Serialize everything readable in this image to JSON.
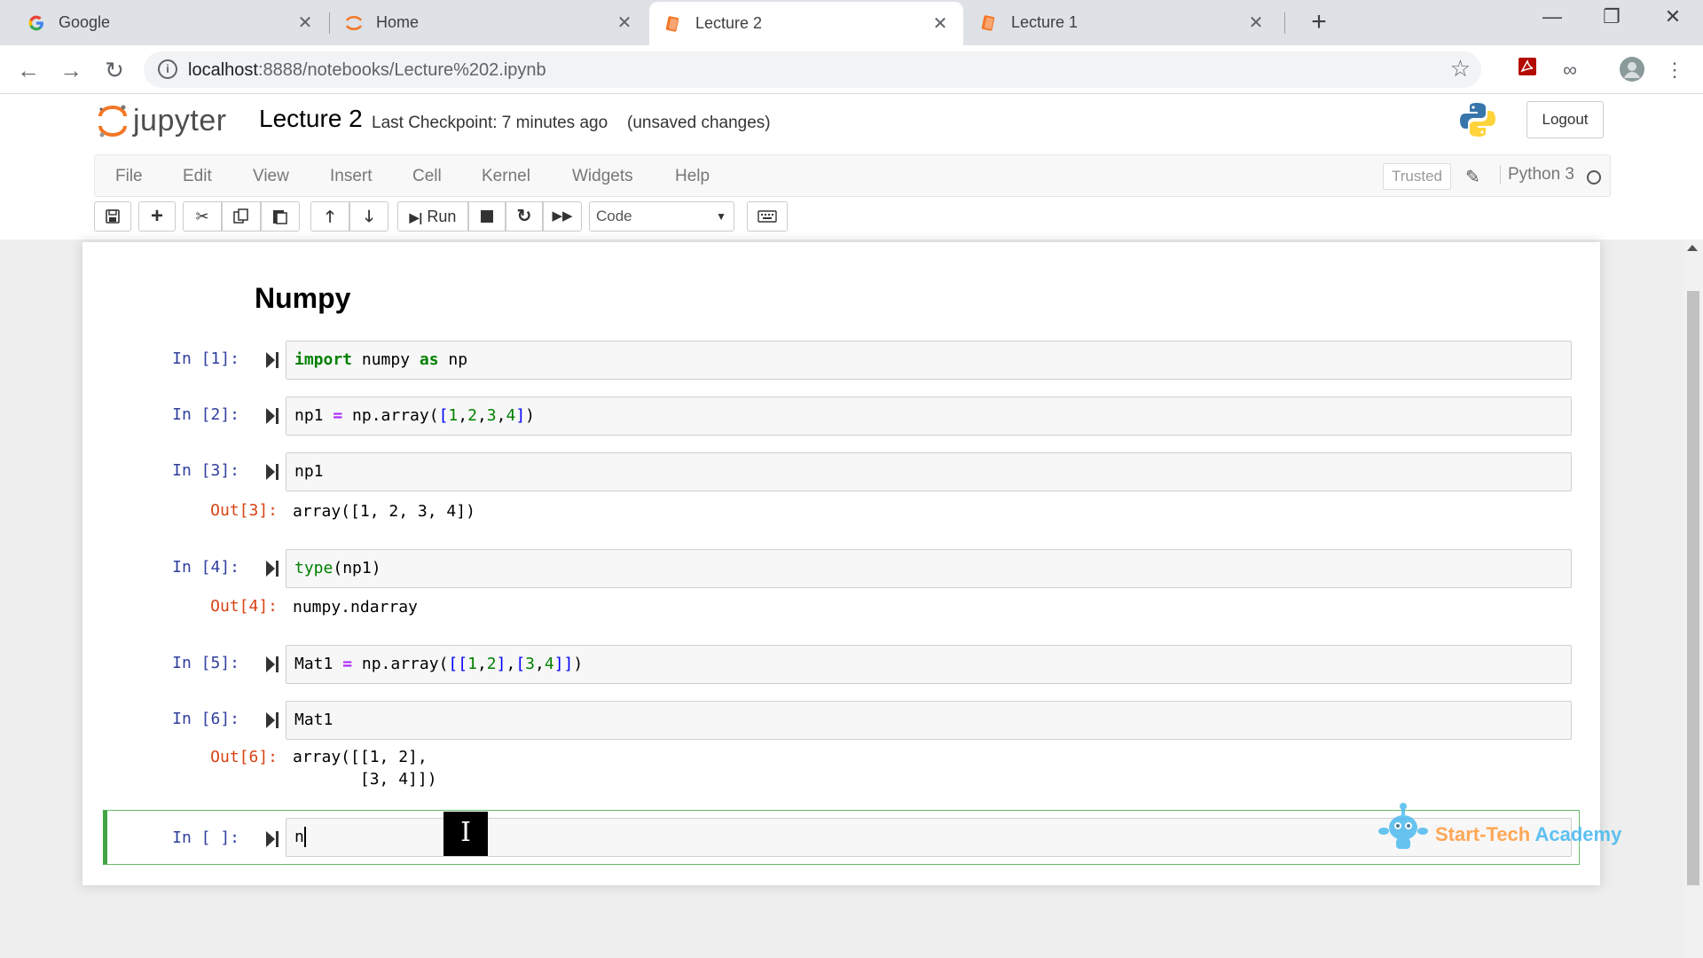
{
  "browser": {
    "tabs": [
      {
        "label": "Google",
        "icon": "google-icon"
      },
      {
        "label": "Home",
        "icon": "jupyter-icon"
      },
      {
        "label": "Lecture 2",
        "icon": "notebook-icon",
        "active": true
      },
      {
        "label": "Lecture 1",
        "icon": "notebook-icon"
      }
    ],
    "url_host": "localhost",
    "url_path": ":8888/notebooks/Lecture%202.ipynb"
  },
  "jupyter": {
    "logo_text": "jupyter",
    "notebook_name": "Lecture 2",
    "checkpoint": "Last Checkpoint: 7 minutes ago",
    "autosave_status": "(unsaved changes)",
    "logout_label": "Logout",
    "menu": [
      "File",
      "Edit",
      "View",
      "Insert",
      "Cell",
      "Kernel",
      "Widgets",
      "Help"
    ],
    "trusted_label": "Trusted",
    "kernel_name": "Python 3",
    "run_label": "Run",
    "cell_type": "Code"
  },
  "notebook": {
    "heading": "Numpy",
    "cells": [
      {
        "in_prompt": "In [1]:"
      },
      {
        "in_prompt": "In [2]:"
      },
      {
        "in_prompt": "In [3]:",
        "out_prompt": "Out[3]:",
        "output": "array([1, 2, 3, 4])"
      },
      {
        "in_prompt": "In [4]:",
        "out_prompt": "Out[4]:",
        "output": "numpy.ndarray"
      },
      {
        "in_prompt": "In [5]:"
      },
      {
        "in_prompt": "In [6]:",
        "out_prompt": "Out[6]:",
        "output": "array([[1, 2],\n       [3, 4]])"
      },
      {
        "in_prompt": "In [ ]:",
        "code": "n"
      }
    ]
  },
  "watermark": {
    "text_a": "Start-Tech ",
    "text_b": "Academy"
  },
  "colors": {
    "in_prompt": "#303f9f",
    "out_prompt": "#d84315",
    "selected_border": "#42a545",
    "keyword": "#008000"
  }
}
